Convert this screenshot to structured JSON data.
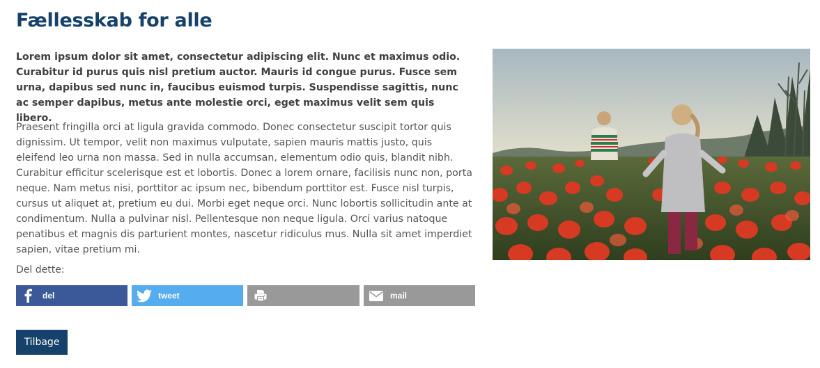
{
  "article": {
    "title": "Fællesskab for alle",
    "lead": "Lorem ipsum dolor sit amet, consectetur adipiscing elit. Nunc et maximus odio. Curabitur id purus quis nisl pretium auctor. Mauris id congue purus. Fusce sem urna, dapibus sed nunc in, faucibus euismod turpis. Suspendisse sagittis, nunc ac semper dapibus, metus ante molestie orci, eget maximus velit sem quis libero.",
    "body": "Praesent fringilla orci at ligula gravida commodo. Donec consectetur suscipit tortor quis dignissim. Ut tempor, velit non maximus vulputate, sapien mauris mattis justo, quis eleifend leo urna non massa. Sed in nulla accumsan, elementum odio quis, blandit nibh. Curabitur efficitur scelerisque est et lobortis. Donec a lorem ornare, facilisis nunc non, porta neque. Nam metus nisi, porttitor ac ipsum nec, bibendum porttitor est. Fusce nisl turpis, cursus ut aliquet at, pretium eu dui. Morbi eget neque orci. Nunc lobortis sollicitudin ante at condimentum. Nulla a pulvinar nisl. Pellentesque non neque ligula. Orci varius natoque penatibus et magnis dis parturient montes, nascetur ridiculus mus. Nulla sit amet imperdiet sapien, vitae pretium mi."
  },
  "share": {
    "label": "Del dette:",
    "buttons": [
      {
        "label": "del",
        "icon": "facebook-icon",
        "color": "#3b5998"
      },
      {
        "label": "tweet",
        "icon": "twitter-icon",
        "color": "#55acee"
      },
      {
        "label": "",
        "icon": "print-icon",
        "color": "#999999"
      },
      {
        "label": "mail",
        "icon": "mail-icon",
        "color": "#999999"
      }
    ]
  },
  "back_button": {
    "label": "Tilbage"
  },
  "colors": {
    "heading": "#15416a",
    "back_button": "#15416a"
  },
  "image": {
    "subject": "children-walking-in-tulip-field"
  }
}
